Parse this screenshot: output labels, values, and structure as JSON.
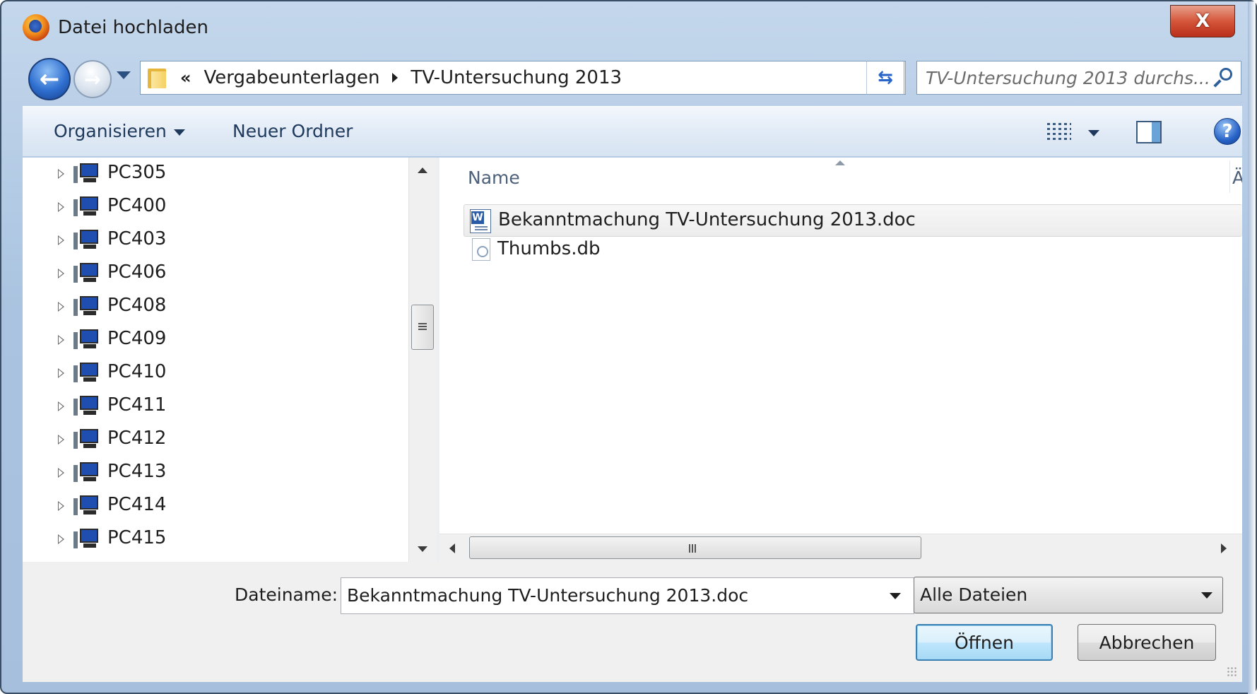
{
  "window": {
    "title": "Datei hochladen",
    "close_label": "X"
  },
  "navigation": {
    "back_icon": "back-arrow-icon",
    "forward_icon": "forward-arrow-icon",
    "address": {
      "overflow_chevron": "«",
      "segments": [
        "Vergabeunterlagen",
        "TV-Untersuchung 2013"
      ]
    },
    "search_placeholder": "TV-Untersuchung 2013 durchs..."
  },
  "toolbar": {
    "organize_label": "Organisieren",
    "new_folder_label": "Neuer Ordner",
    "help_label": "?"
  },
  "nav_pane": {
    "items": [
      {
        "label": "PC305"
      },
      {
        "label": "PC400"
      },
      {
        "label": "PC403"
      },
      {
        "label": "PC406"
      },
      {
        "label": "PC408"
      },
      {
        "label": "PC409"
      },
      {
        "label": "PC410"
      },
      {
        "label": "PC411"
      },
      {
        "label": "PC412"
      },
      {
        "label": "PC413"
      },
      {
        "label": "PC414"
      },
      {
        "label": "PC415"
      }
    ]
  },
  "file_list": {
    "columns": [
      "Name",
      "Ä"
    ],
    "files": [
      {
        "name": "Bekanntmachung TV-Untersuchung 2013.doc",
        "type_icon": "word-document-icon",
        "selected": true,
        "extra": "0"
      },
      {
        "name": "Thumbs.db",
        "type_icon": "database-file-icon",
        "selected": false,
        "extra": "1"
      }
    ]
  },
  "bottom": {
    "filename_label": "Dateiname:",
    "filename_value": "Bekanntmachung TV-Untersuchung 2013.doc",
    "filetype_value": "Alle Dateien",
    "open_label": "Öffnen",
    "cancel_label": "Abbrechen"
  },
  "colors": {
    "frame": "#a9c3e0",
    "toolbar_text": "#1e395b",
    "close_red": "#c9432a",
    "default_button_border": "#3c7fb1"
  }
}
